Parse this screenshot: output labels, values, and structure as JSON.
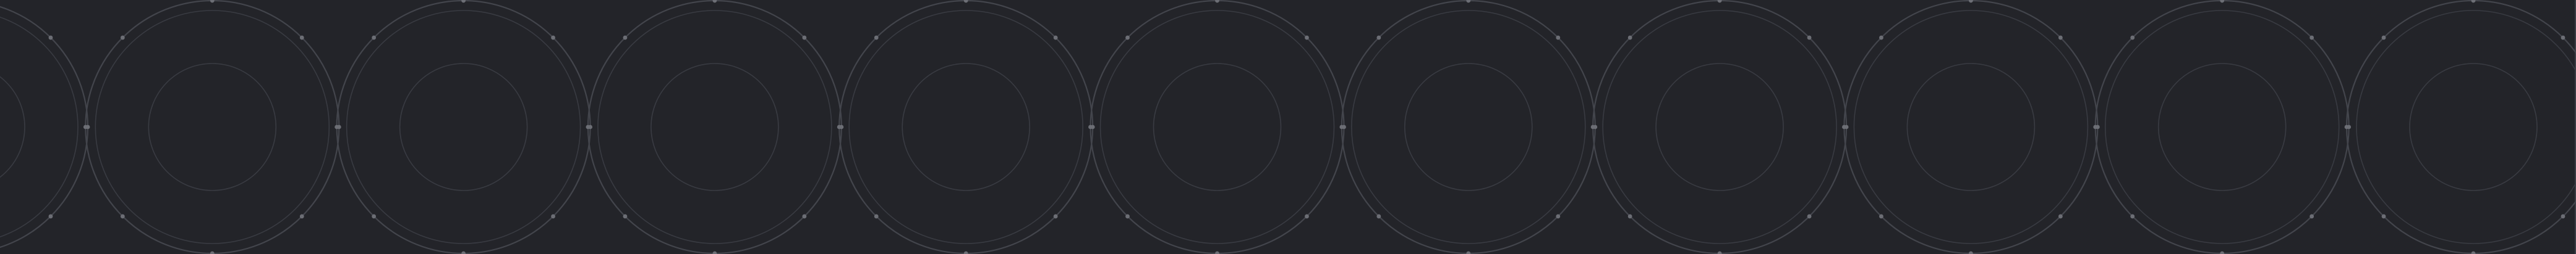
{
  "pattern": {
    "motif": "concentric-circles",
    "colors": {
      "background": "#232429",
      "outer_ring": "#43454c",
      "inner_rings": "#393b42",
      "dots": "#6c6e75"
    }
  }
}
